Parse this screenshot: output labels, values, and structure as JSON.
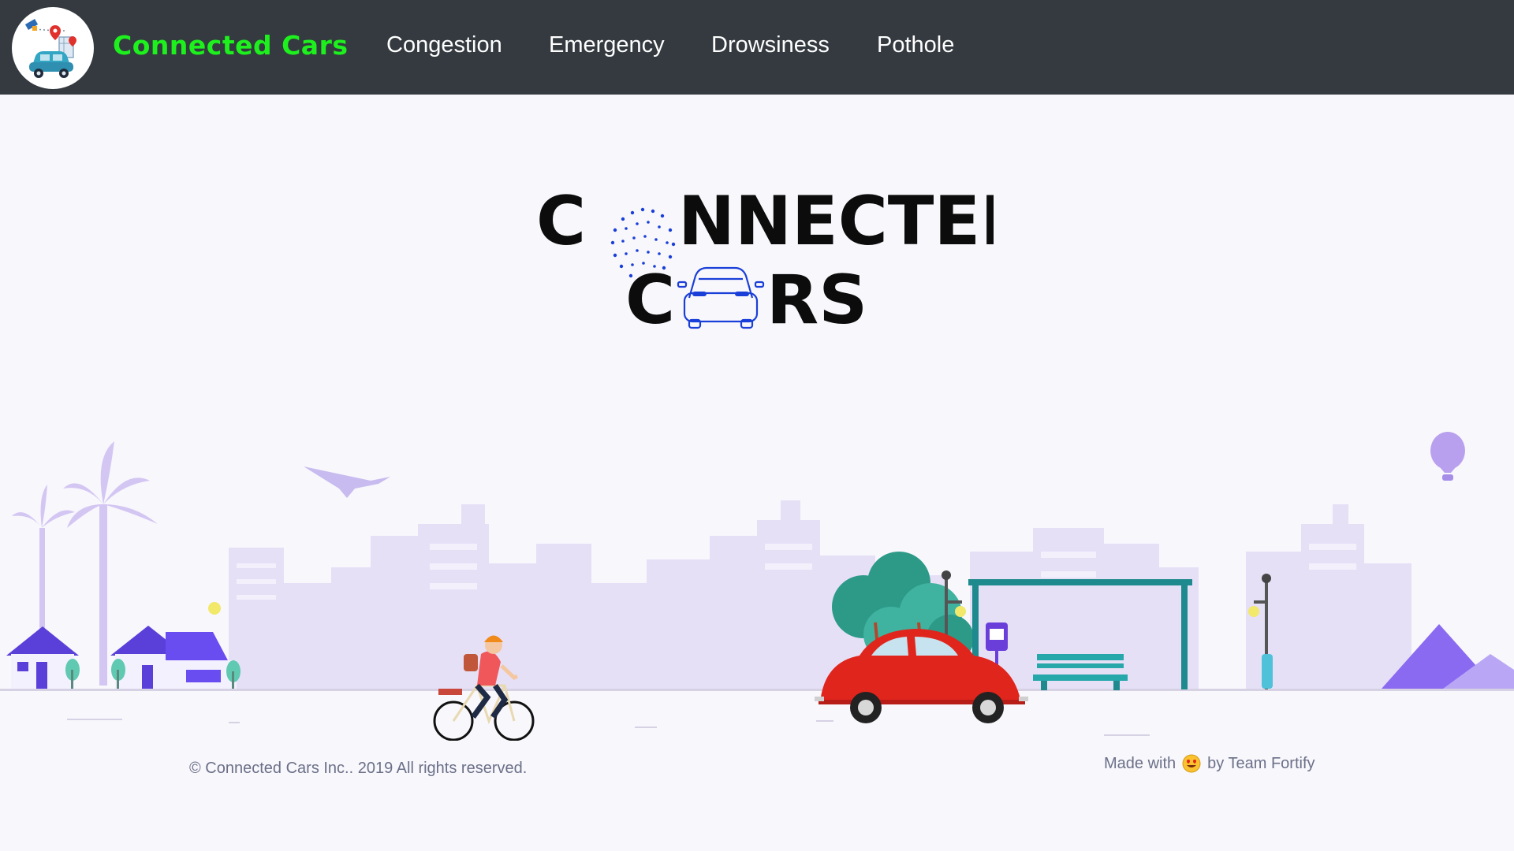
{
  "navbar": {
    "brand": "Connected Cars",
    "items": [
      {
        "label": "Congestion"
      },
      {
        "label": "Emergency"
      },
      {
        "label": "Drowsiness"
      },
      {
        "label": "Pothole"
      }
    ]
  },
  "hero": {
    "line1_letter_c": "C",
    "line1_rest": "NNECTED",
    "line2_letter_c": "C",
    "line2_rest": "RS"
  },
  "footer": {
    "copyright": "© Connected Cars Inc.. 2019 All rights reserved.",
    "made_with": "Made with",
    "by_team": "by Team Fortify",
    "emoji_icon": "heart-eyes-emoji-icon"
  },
  "colors": {
    "navbar_bg": "#343a40",
    "brand_green": "#1df01d",
    "page_bg": "#f8f7fc",
    "accent_blue": "#1a3fd8",
    "car_red": "#e0251c",
    "city_lavender": "#e6e0f7"
  }
}
